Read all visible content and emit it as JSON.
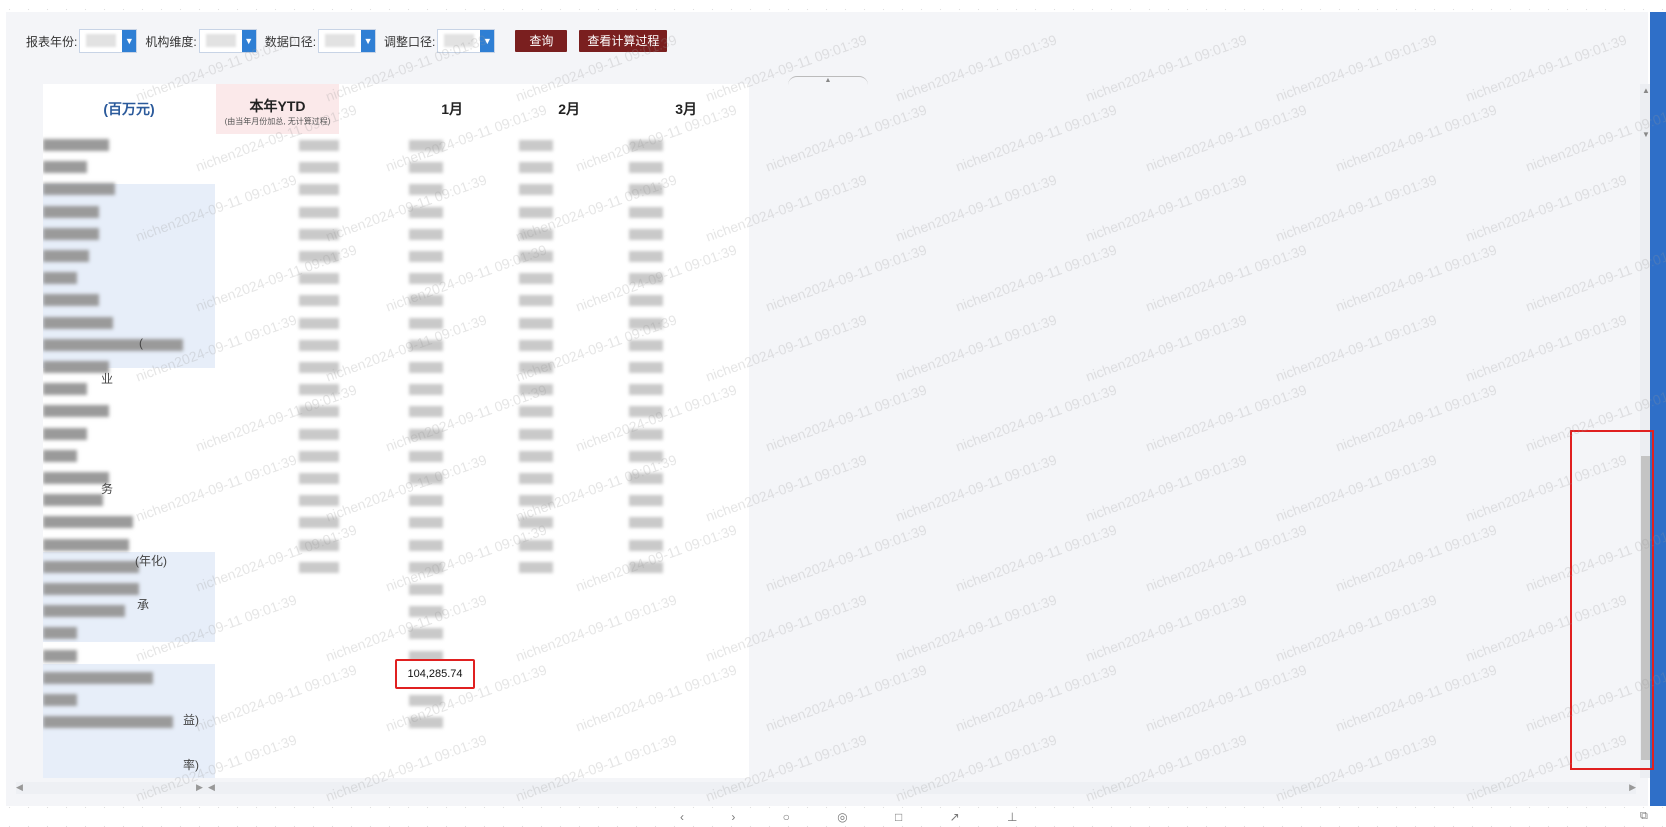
{
  "filters": [
    {
      "label": "报表年份:"
    },
    {
      "label": "机构维度:"
    },
    {
      "label": "数据口径:"
    },
    {
      "label": "调整口径:"
    }
  ],
  "buttons": {
    "query": "查询",
    "calc": "查看计算过程"
  },
  "table": {
    "unit": "(百万元)",
    "ytd_title": "本年YTD",
    "ytd_sub": "(由当年月份加总, 无计算过程)",
    "months": [
      "1月",
      "2月",
      "3月"
    ],
    "suffix_annual": "(年化)",
    "suffix_paren_a": "(",
    "suffix_paren_b": "(",
    "suffix_cheng": "承",
    "suffix_ye": "业",
    "suffix_wu": "务",
    "suffix_end_a": "益)",
    "suffix_end_b": "率)",
    "highlight_value": "104,285.74"
  },
  "watermark": "nichen2024-09-11 09:01:39",
  "colors": {
    "query_btn": "#7a1f1f",
    "select_arrow": "#2f7fd4",
    "highlight_border": "#e02020",
    "scroll_bar": "#2f6fc8"
  }
}
